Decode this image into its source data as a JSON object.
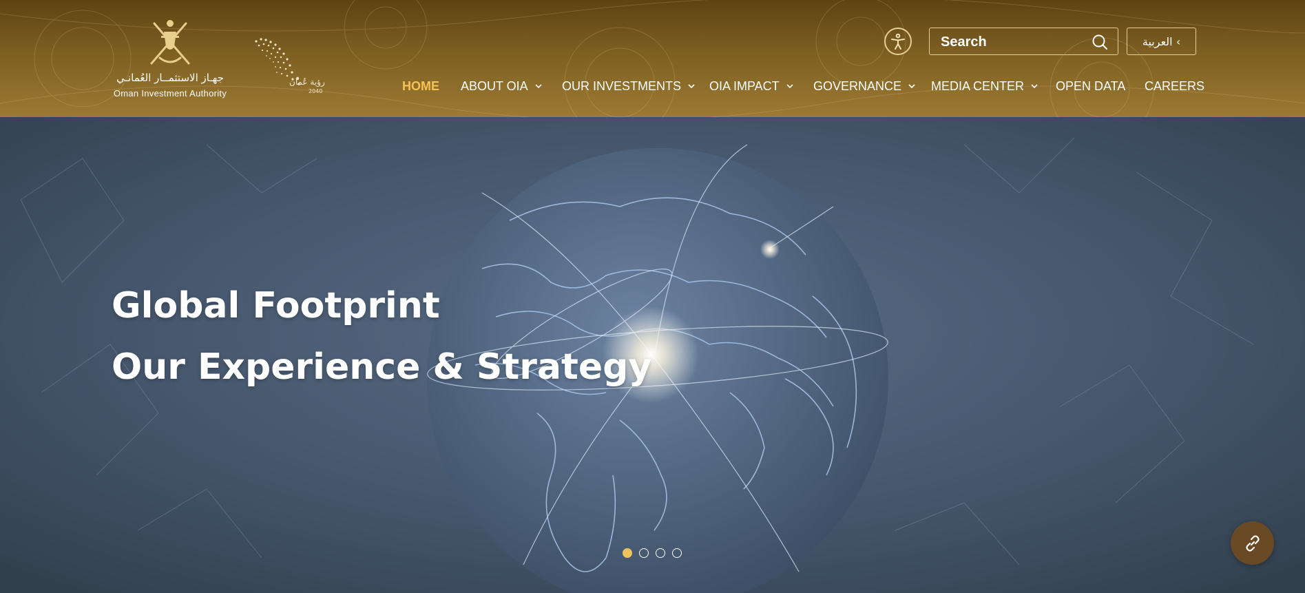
{
  "header": {
    "logo": {
      "arabic_name": "جهـاز الاستثمــار العُمانـي",
      "english_name": "Oman Investment Authority"
    },
    "vision_logo": {
      "arabic_text": "رؤية عُمان",
      "year": "2040"
    },
    "accessibility_icon": "accessibility-icon",
    "search": {
      "placeholder": "Search",
      "value": ""
    },
    "language_button": "العربية ‹"
  },
  "nav": {
    "items": [
      {
        "label": "HOME",
        "active": true,
        "has_dropdown": false
      },
      {
        "label": "ABOUT OIA",
        "active": false,
        "has_dropdown": true
      },
      {
        "label": "OUR INVESTMENTS",
        "active": false,
        "has_dropdown": true
      },
      {
        "label": "OIA IMPACT",
        "active": false,
        "has_dropdown": true
      },
      {
        "label": "GOVERNANCE",
        "active": false,
        "has_dropdown": true
      },
      {
        "label": "MEDIA CENTER",
        "active": false,
        "has_dropdown": true
      },
      {
        "label": "OPEN DATA",
        "active": false,
        "has_dropdown": false
      },
      {
        "label": "CAREERS",
        "active": false,
        "has_dropdown": false
      }
    ]
  },
  "hero": {
    "line1": "Global Footprint",
    "line2": "Our Experience & Strategy",
    "slides_total": 4,
    "active_slide": 1
  },
  "colors": {
    "header_gold": "#7e5f22",
    "accent": "#f6c155",
    "hero_bg": "#3f5065",
    "share_button": "#6a4a24"
  },
  "share_button_icon": "link-icon"
}
